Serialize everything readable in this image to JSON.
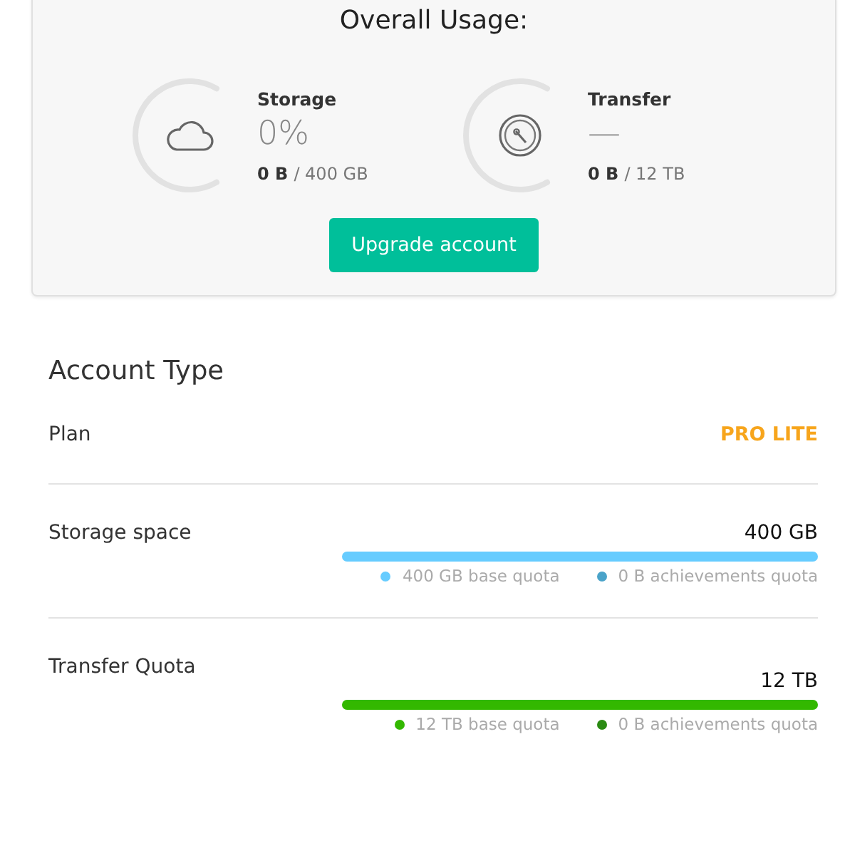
{
  "overall_usage": {
    "title": "Overall Usage:",
    "gauges": [
      {
        "kind": "storage",
        "label": "Storage",
        "reading": "0%",
        "used": "0 B",
        "total": "/ 400 GB"
      },
      {
        "kind": "transfer",
        "label": "Transfer",
        "reading": "—",
        "used": "0 B",
        "total": "/ 12 TB"
      }
    ],
    "button": "Upgrade account"
  },
  "account_type": {
    "title": "Account Type",
    "rows": [
      {
        "kind": "plan",
        "label": "Plan",
        "value": "PRO LITE"
      },
      {
        "kind": "quota",
        "label": "Storage space",
        "value": "400 GB",
        "segments": [
          {
            "label": "400 GB base quota",
            "color": "#66ccff"
          },
          {
            "label": "0 B achievements quota",
            "color": "#4aa3c9"
          }
        ]
      },
      {
        "kind": "quota",
        "label": "Transfer Quota",
        "value": "12 TB",
        "segments": [
          {
            "label": "12 TB base quota",
            "color": "#33b800"
          },
          {
            "label": "0 B achievements quota",
            "color": "#2a8a12"
          }
        ]
      }
    ]
  }
}
